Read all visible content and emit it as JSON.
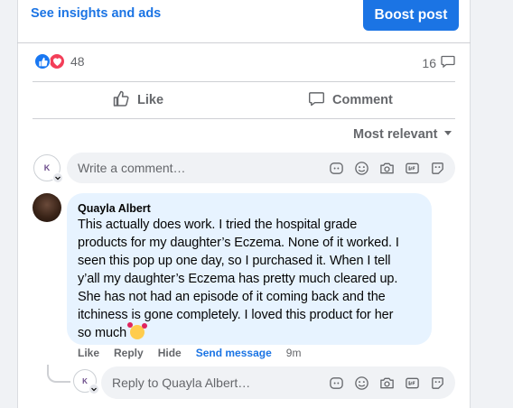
{
  "post_footer": {
    "insights_link": "See insights and ads",
    "boost_button": "Boost post"
  },
  "stats": {
    "reaction_count": "48",
    "comment_count": "16"
  },
  "actions": {
    "like": "Like",
    "comment": "Comment"
  },
  "sort": {
    "label": "Most relevant"
  },
  "composer": {
    "placeholder": "Write a comment…",
    "page_avatar_text": "K"
  },
  "comment": {
    "author": "Quayla Albert",
    "lines": [
      "This actually does work. I tried the hospital grade",
      "products for my daughter’s Eczema. None of it worked. I",
      "seen this pop up one day, so I purchased it. When I tell",
      "y’all my daughter’s Eczema has pretty much cleared up.",
      "She has not had an episode of it coming back and the",
      "itchiness is gone completely. I loved this product for her",
      "so much"
    ],
    "actions": {
      "like": "Like",
      "reply": "Reply",
      "hide": "Hide",
      "send_message": "Send message",
      "time": "9m"
    }
  },
  "reply_composer": {
    "placeholder": "Reply to Quayla Albert…"
  },
  "colors": {
    "accent": "#1b74e4",
    "bubble": "#e7f3ff",
    "muted": "#65676b"
  }
}
